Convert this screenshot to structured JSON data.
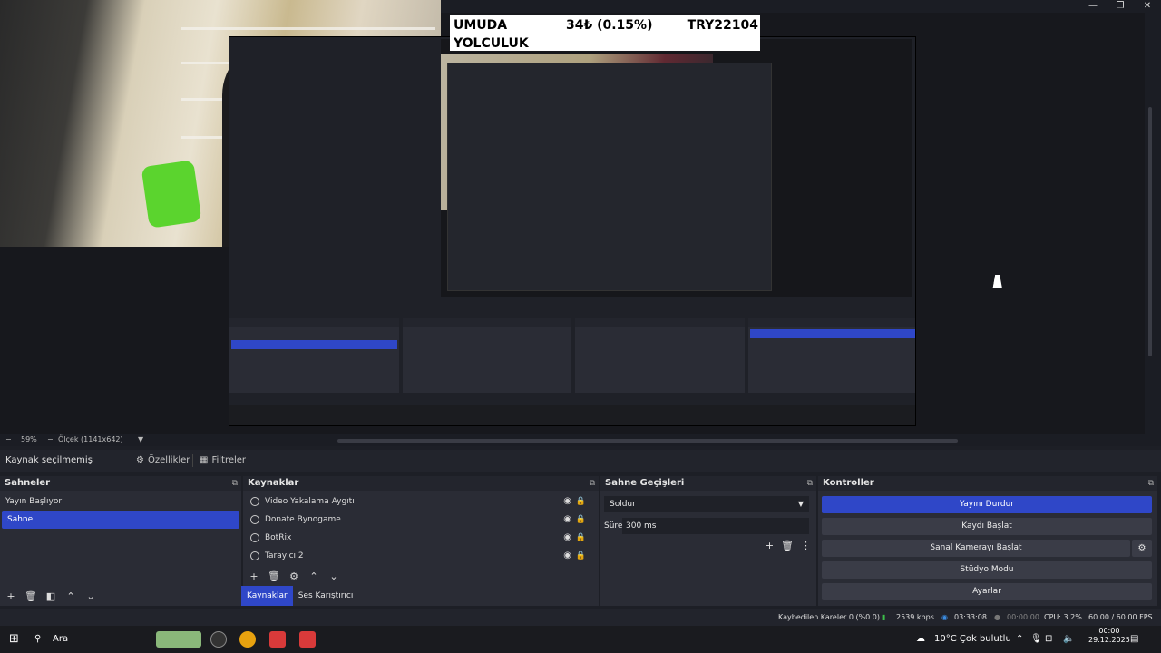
{
  "window": {
    "controls": {
      "minimize": "—",
      "maximize": "❐",
      "close": "✕"
    }
  },
  "overlay": {
    "name": "UMUDA YOLCULUK",
    "change": "34₺ (0.15%)",
    "goal": "TRY22104"
  },
  "zoom_bar": {
    "zoom": "59%",
    "scale": "Ölçek (1141x642)"
  },
  "source_toolbar": {
    "no_source": "Kaynak seçilmemiş",
    "properties": "Özellikler",
    "filters": "Filtreler"
  },
  "scenes": {
    "title": "Sahneler",
    "items": [
      {
        "label": "Yayın Başlıyor"
      },
      {
        "label": "Sahne"
      }
    ]
  },
  "sources": {
    "title": "Kaynaklar",
    "items": [
      {
        "label": "Video Yakalama Aygıtı"
      },
      {
        "label": "Donate Bynogame"
      },
      {
        "label": "BotRix"
      },
      {
        "label": "Tarayıcı 2"
      }
    ],
    "tabs": {
      "sources": "Kaynaklar",
      "mixer": "Ses Karıştırıcı"
    }
  },
  "transitions": {
    "title": "Sahne Geçişleri",
    "selected": "Soldur",
    "duration_label": "Süre",
    "duration": "300 ms"
  },
  "controls": {
    "title": "Kontroller",
    "stop_stream": "Yayını Durdur",
    "start_recording": "Kaydı Başlat",
    "virtual_cam": "Sanal Kamerayı Başlat",
    "studio_mode": "Stüdyo Modu",
    "settings": "Ayarlar"
  },
  "status": {
    "dropped": "Kaybedilen Kareler 0 (%0.0)",
    "bitrate": "2539 kbps",
    "stream_time": "03:33:08",
    "rec_time": "00:00:00",
    "cpu": "CPU: 3.2%",
    "fps": "60.00 / 60.00 FPS"
  },
  "taskbar": {
    "search": "Ara",
    "weather": "10°C  Çok bulutlu",
    "time": "00:00",
    "date": "29.12.2025"
  },
  "colors": {
    "accent": "#2f47c8",
    "panel": "#2a2c35",
    "background": "#1d1f26"
  }
}
